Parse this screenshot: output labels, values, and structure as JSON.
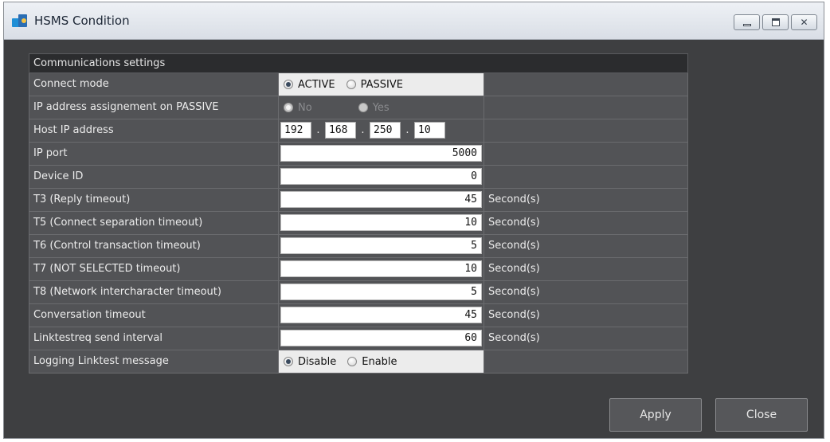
{
  "window": {
    "title": "HSMS Condition",
    "min_icon": "minimize-icon",
    "max_icon": "maximize-icon",
    "close_icon": "close-icon"
  },
  "section": {
    "title": "Communications settings"
  },
  "connect_mode": {
    "label": "Connect mode",
    "options": [
      "ACTIVE",
      "PASSIVE"
    ],
    "selected": "ACTIVE"
  },
  "ip_assign": {
    "label": "IP address assignement on PASSIVE",
    "options": [
      "No",
      "Yes"
    ],
    "selected": "No"
  },
  "host_ip": {
    "label": "Host IP address",
    "octets": [
      "192",
      "168",
      "250",
      "10"
    ],
    "sep": "."
  },
  "ip_port": {
    "label": "IP port",
    "value": "5000"
  },
  "device_id": {
    "label": "Device ID",
    "value": "0"
  },
  "timeouts": [
    {
      "label": "T3 (Reply timeout)",
      "value": "45",
      "unit": "Second(s)"
    },
    {
      "label": "T5 (Connect separation timeout)",
      "value": "10",
      "unit": "Second(s)"
    },
    {
      "label": "T6 (Control transaction timeout)",
      "value": "5",
      "unit": "Second(s)"
    },
    {
      "label": "T7 (NOT SELECTED timeout)",
      "value": "10",
      "unit": "Second(s)"
    },
    {
      "label": "T8 (Network intercharacter timeout)",
      "value": "5",
      "unit": "Second(s)"
    },
    {
      "label": "Conversation timeout",
      "value": "45",
      "unit": "Second(s)"
    },
    {
      "label": "Linktestreq send interval",
      "value": "60",
      "unit": "Second(s)"
    }
  ],
  "logging": {
    "label": "Logging Linktest message",
    "options": [
      "Disable",
      "Enable"
    ],
    "selected": "Disable"
  },
  "buttons": {
    "apply": "Apply",
    "close": "Close"
  }
}
